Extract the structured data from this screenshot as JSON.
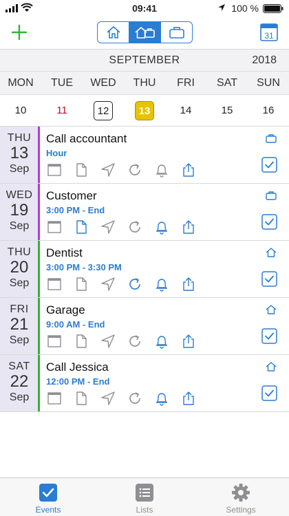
{
  "status_bar": {
    "time": "09:41",
    "battery": "100 %"
  },
  "calendar": {
    "month": "SEPTEMBER",
    "year": "2018",
    "weekdays": [
      "MON",
      "TUE",
      "WED",
      "THU",
      "FRI",
      "SAT",
      "SUN"
    ],
    "dates": [
      "10",
      "11",
      "12",
      "13",
      "14",
      "15",
      "16"
    ]
  },
  "colors": {
    "accent": "#2b7cd3",
    "selected_day": "#e7c300",
    "work": "#b43bd4",
    "home": "#36b03a",
    "sunday": "#c0101a"
  },
  "events": [
    {
      "dow": "THU",
      "day": "13",
      "mon": "Sep",
      "title": "Call accountant",
      "time": "Hour",
      "category": "work",
      "type_icon": "briefcase-icon"
    },
    {
      "dow": "WED",
      "day": "19",
      "mon": "Sep",
      "title": "Customer",
      "time": "3:00 PM - End",
      "category": "work",
      "type_icon": "briefcase-icon"
    },
    {
      "dow": "THU",
      "day": "20",
      "mon": "Sep",
      "title": "Dentist",
      "time": "3:00 PM - 3:30 PM",
      "category": "home",
      "type_icon": "home-icon"
    },
    {
      "dow": "FRI",
      "day": "21",
      "mon": "Sep",
      "title": "Garage",
      "time": "9:00 AM - End",
      "category": "home",
      "type_icon": "home-icon"
    },
    {
      "dow": "SAT",
      "day": "22",
      "mon": "Sep",
      "title": "Call Jessica",
      "time": "12:00 PM - End",
      "category": "home",
      "type_icon": "home-icon"
    }
  ],
  "tabs": [
    {
      "label": "Events",
      "icon": "events-check-icon"
    },
    {
      "label": "Lists",
      "icon": "list-icon"
    },
    {
      "label": "Settings",
      "icon": "gear-icon"
    }
  ],
  "calendar_icon_day": "31"
}
